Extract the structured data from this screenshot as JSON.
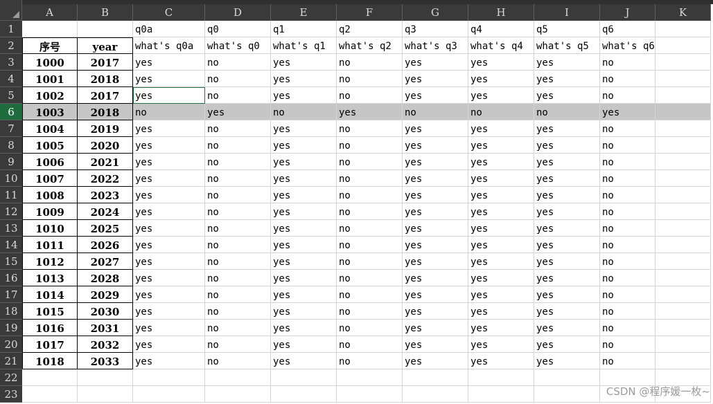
{
  "columns": [
    "A",
    "B",
    "C",
    "D",
    "E",
    "F",
    "G",
    "H",
    "I",
    "J",
    "K"
  ],
  "rows": [
    "1",
    "2",
    "3",
    "4",
    "5",
    "6",
    "7",
    "8",
    "9",
    "10",
    "11",
    "12",
    "13",
    "14",
    "15",
    "16",
    "17",
    "18",
    "19",
    "20",
    "21",
    "22",
    "23"
  ],
  "active_row": "6",
  "header_row1": [
    "",
    "",
    "q0a",
    "q0",
    "q1",
    "q2",
    "q3",
    "q4",
    "q5",
    "q6",
    ""
  ],
  "header_row2": [
    "序号",
    "year",
    "what's q0a",
    "what's q0",
    "what's q1",
    "what's q2",
    "what's q3",
    "what's q4",
    "what's q5",
    "what's q6",
    ""
  ],
  "data_rows": [
    [
      "1000",
      "2017",
      "yes",
      "no",
      "yes",
      "no",
      "yes",
      "yes",
      "yes",
      "no"
    ],
    [
      "1001",
      "2018",
      "yes",
      "no",
      "yes",
      "no",
      "yes",
      "yes",
      "yes",
      "no"
    ],
    [
      "1002",
      "2017",
      "yes",
      "no",
      "yes",
      "no",
      "yes",
      "yes",
      "yes",
      "no"
    ],
    [
      "1003",
      "2018",
      "no",
      "yes",
      "no",
      "yes",
      "no",
      "no",
      "no",
      "yes"
    ],
    [
      "1004",
      "2019",
      "yes",
      "no",
      "yes",
      "no",
      "yes",
      "yes",
      "yes",
      "no"
    ],
    [
      "1005",
      "2020",
      "yes",
      "no",
      "yes",
      "no",
      "yes",
      "yes",
      "yes",
      "no"
    ],
    [
      "1006",
      "2021",
      "yes",
      "no",
      "yes",
      "no",
      "yes",
      "yes",
      "yes",
      "no"
    ],
    [
      "1007",
      "2022",
      "yes",
      "no",
      "yes",
      "no",
      "yes",
      "yes",
      "yes",
      "no"
    ],
    [
      "1008",
      "2023",
      "yes",
      "no",
      "yes",
      "no",
      "yes",
      "yes",
      "yes",
      "no"
    ],
    [
      "1009",
      "2024",
      "yes",
      "no",
      "yes",
      "no",
      "yes",
      "yes",
      "yes",
      "no"
    ],
    [
      "1010",
      "2025",
      "yes",
      "no",
      "yes",
      "no",
      "yes",
      "yes",
      "yes",
      "no"
    ],
    [
      "1011",
      "2026",
      "yes",
      "no",
      "yes",
      "no",
      "yes",
      "yes",
      "yes",
      "no"
    ],
    [
      "1012",
      "2027",
      "yes",
      "no",
      "yes",
      "no",
      "yes",
      "yes",
      "yes",
      "no"
    ],
    [
      "1013",
      "2028",
      "yes",
      "no",
      "yes",
      "no",
      "yes",
      "yes",
      "yes",
      "no"
    ],
    [
      "1014",
      "2029",
      "yes",
      "no",
      "yes",
      "no",
      "yes",
      "yes",
      "yes",
      "no"
    ],
    [
      "1015",
      "2030",
      "yes",
      "no",
      "yes",
      "no",
      "yes",
      "yes",
      "yes",
      "no"
    ],
    [
      "1016",
      "2031",
      "yes",
      "no",
      "yes",
      "no",
      "yes",
      "yes",
      "yes",
      "no"
    ],
    [
      "1017",
      "2032",
      "yes",
      "no",
      "yes",
      "no",
      "yes",
      "yes",
      "yes",
      "no"
    ],
    [
      "1018",
      "2033",
      "yes",
      "no",
      "yes",
      "no",
      "yes",
      "yes",
      "yes",
      "no"
    ]
  ],
  "selected_cell": "C5",
  "watermark": "CSDN @程序媛一枚~",
  "colors": {
    "header_bg": "#3a3a3a",
    "active_row_header": "#1e6b3e",
    "selected_row_bg": "#c6c6c6"
  }
}
